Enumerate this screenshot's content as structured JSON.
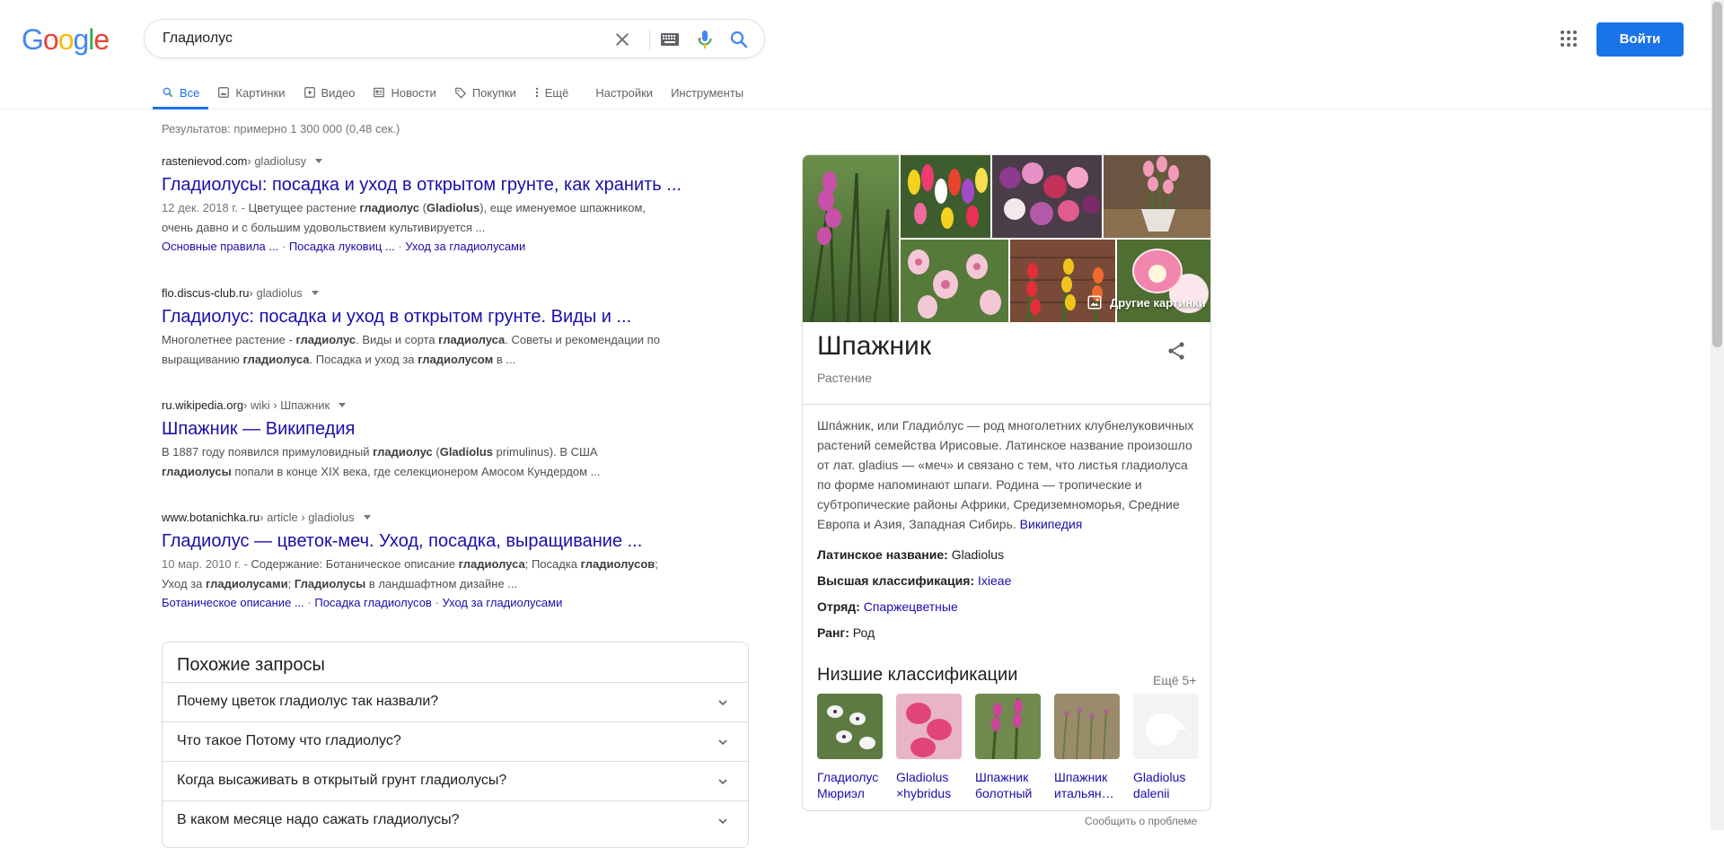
{
  "logo": {
    "letters": [
      "G",
      "o",
      "o",
      "g",
      "l",
      "e"
    ],
    "colors": [
      "#4285f4",
      "#ea4335",
      "#fbbc05",
      "#4285f4",
      "#34a853",
      "#ea4335"
    ]
  },
  "search": {
    "query": "Гладиолус"
  },
  "header": {
    "signin_label": "Войти"
  },
  "tabs": [
    {
      "label": "Все",
      "icon": "search-icon",
      "active": true
    },
    {
      "label": "Картинки",
      "icon": "image-icon"
    },
    {
      "label": "Видео",
      "icon": "video-icon"
    },
    {
      "label": "Новости",
      "icon": "news-icon"
    },
    {
      "label": "Покупки",
      "icon": "tag-icon"
    },
    {
      "label": "Ещё",
      "icon": "more-vert-icon"
    },
    {
      "label": "Настройки"
    },
    {
      "label": "Инструменты"
    }
  ],
  "result_stats": "Результатов: примерно 1 300 000 (0,48 сек.)",
  "results": [
    {
      "domain": "rastenievod.com",
      "path": " › gladiolusy",
      "title": "Гладиолусы: посадка и уход в открытом грунте, как хранить ...",
      "date": "12 дек. 2018 г. - ",
      "snippet_line1_a": "Цветущее растение ",
      "snippet_line1_b1": "гладиолус",
      "snippet_line1_c": " (",
      "snippet_line1_b2": "Gladiolus",
      "snippet_line1_d": "), еще именуемое шпажником,",
      "snippet_line2": "очень давно и с большим удовольствием культивируется ...",
      "sitelinks": [
        "Основные правила ...",
        "Посадка луковиц ...",
        "Уход за гладиолусами"
      ]
    },
    {
      "domain": "flo.discus-club.ru",
      "path": " › gladiolus",
      "title": "Гладиолус: посадка и уход в открытом грунте. Виды и ...",
      "snippet_line1_a": "Многолетнее растение - ",
      "snippet_line1_b1": "гладиолус",
      "snippet_line1_c": ". Виды и сорта ",
      "snippet_line1_b2": "гладиолуса",
      "snippet_line1_d": ". Советы и рекомендации по",
      "snippet_line2_a": "выращиванию ",
      "snippet_line2_b1": "гладиолуса",
      "snippet_line2_c": ". Посадка и уход за ",
      "snippet_line2_b2": "гладиолусом",
      "snippet_line2_d": " в ..."
    },
    {
      "domain": "ru.wikipedia.org",
      "path": " › wiki › Шпажник",
      "title": "Шпажник — Википедия",
      "snippet_line1_a": "В 1887 году появился примуловидный ",
      "snippet_line1_b1": "гладиолус",
      "snippet_line1_c": " (",
      "snippet_line1_b2": "Gladiolus",
      "snippet_line1_d": " primulinus). В США",
      "snippet_line2_b1": "гладиолусы",
      "snippet_line2_c": " попали в конце XIX века, где селекционером Амосом Кундердом ..."
    },
    {
      "domain": "www.botanichka.ru",
      "path": " › article › gladiolus",
      "title": "Гладиолус — цветок-меч. Уход, посадка, выращивание ...",
      "date": "10 мар. 2010 г. - ",
      "snippet_line1_a": "Содержание: Ботаническое описание ",
      "snippet_line1_b1": "гладиолуса",
      "snippet_line1_c": "; Посадка ",
      "snippet_line1_b2": "гладиолусов",
      "snippet_line1_d": ";",
      "snippet_line2_a": "Уход за ",
      "snippet_line2_b1": "гладиолусами",
      "snippet_line2_c": "; ",
      "snippet_line2_b2": "Гладиолусы",
      "snippet_line2_d": " в ландшафтном дизайне ...",
      "sitelinks": [
        "Ботаническое описание ...",
        "Посадка гладиолусов",
        "Уход за гладиолусами"
      ]
    }
  ],
  "related": {
    "title": "Похожие запросы",
    "items": [
      "Почему цветок гладиолус так назвали?",
      "Что такое Потому что гладиолус?",
      "Когда высаживать в открытый грунт гладиолусы?",
      "В каком месяце надо сажать гладиолусы?"
    ]
  },
  "knowledge_panel": {
    "more_images": "Другие картинки",
    "title": "Шпажник",
    "subtitle": "Растение",
    "description": "Шпа́жник, или Гладио́лус — род многолетних клубнелуковичных растений семейства Ирисовые. Латинское название произошло от лат. gladius — «меч» и связано с тем, что листья гладиолуса по форме напоминают шпаги. Родина — тропические и субтропические районы Африки, Средиземноморья, Средние Европа и Азия, Западная Сибирь. ",
    "description_link": "Википедия",
    "facts": [
      {
        "label": "Латинское название:",
        "value": " Gladiolus",
        "link": false
      },
      {
        "label": "Высшая классификация:",
        "value": "Ixieae",
        "link": true
      },
      {
        "label": "Отряд:",
        "value": "Спаржецветные",
        "link": true
      },
      {
        "label": "Ранг:",
        "value": " Род",
        "link": false
      }
    ],
    "lower_title": "Низшие классификации",
    "lower_more": "Ещё 5+",
    "lower_items": [
      {
        "line1": "Гладиолус",
        "line2": "Мюриэл"
      },
      {
        "line1": "Gladiolus",
        "line2": "×hybridus"
      },
      {
        "line1": "Шпажник",
        "line2": "болотный"
      },
      {
        "line1": "Шпажник",
        "line2": "итальян…"
      },
      {
        "line1": "Gladiolus",
        "line2": "dalenii"
      }
    ],
    "report": "Сообщить о проблеме"
  }
}
